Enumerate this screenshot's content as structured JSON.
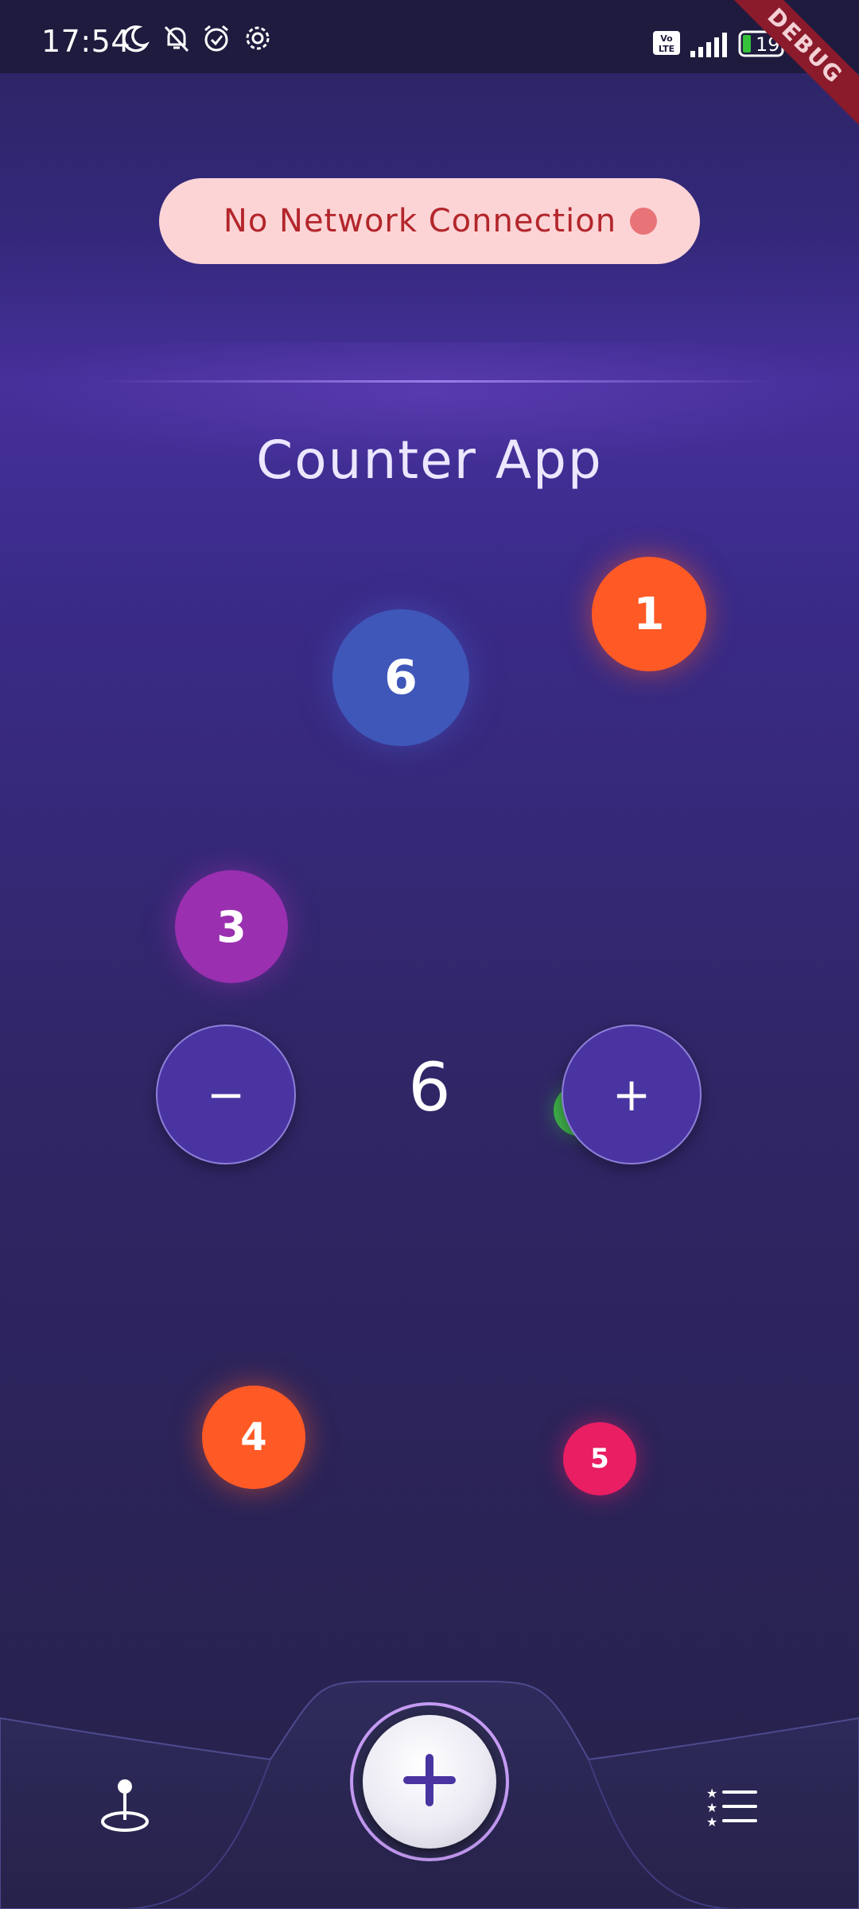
{
  "status_bar": {
    "time": "17:54",
    "battery": "19",
    "icons": [
      "moon-icon",
      "bell-off-icon",
      "alarm-icon",
      "settings-icon",
      "volte-icon",
      "signal-icon",
      "battery-icon"
    ]
  },
  "debug_ribbon": "DEBUG",
  "network_banner": {
    "text": "No Network Connection",
    "status_color": "#e87478"
  },
  "app": {
    "title": "Counter App",
    "counter_value": "6"
  },
  "controls": {
    "decrement_label": "−",
    "increment_label": "+"
  },
  "floating_balls": [
    {
      "label": "1",
      "color": "#ff5a26"
    },
    {
      "label": "6",
      "color": "#3f57b8"
    },
    {
      "label": "3",
      "color": "#9a2fb0"
    },
    {
      "label": "4",
      "color": "#ff5a26"
    },
    {
      "label": "5",
      "color": "#e91e63"
    }
  ],
  "bottom_nav": {
    "left_icon": "location-pin-icon",
    "center_icon": "add-icon",
    "right_icon": "starred-list-icon"
  }
}
